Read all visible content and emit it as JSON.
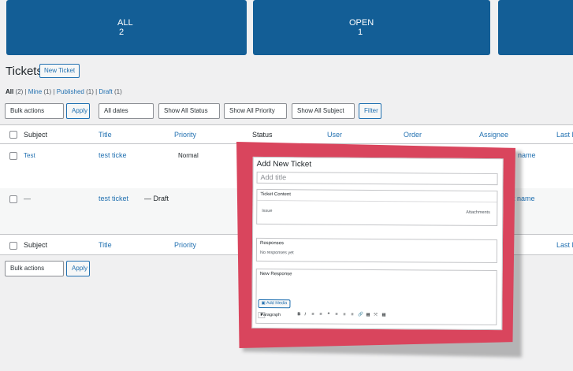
{
  "stats": {
    "all": {
      "label": "ALL",
      "value": "2"
    },
    "open": {
      "label": "OPEN",
      "value": "1"
    }
  },
  "header": {
    "title": "Tickets",
    "new_button": "New Ticket"
  },
  "filters": {
    "all": "All",
    "all_count": "(2)",
    "mine": "Mine",
    "mine_count": "(1)",
    "published": "Published",
    "published_count": "(1)",
    "draft": "Draft",
    "draft_count": "(1)",
    "separator": "|"
  },
  "toolbar": {
    "bulk_actions": "Bulk actions",
    "apply": "Apply",
    "all_dates": "All dates",
    "show_all_status": "Show All Status",
    "show_all_priority": "Show All Priority",
    "show_all_subject": "Show All Subject",
    "filter": "Filter"
  },
  "table": {
    "columns": [
      "Subject",
      "Title",
      "Priority",
      "Status",
      "User",
      "Order",
      "Assignee",
      "Last R"
    ],
    "rows": [
      {
        "subject": "Test",
        "title": "test ticke",
        "priority": "Normal",
        "assignee_partial": "name"
      },
      {
        "subject": "—",
        "title": "test ticket",
        "title_suffix": "— Draft",
        "assignee_partial": "t name"
      }
    ]
  },
  "bottom_toolbar": {
    "bulk_actions": "Bulk actions",
    "apply": "Apply"
  },
  "modal": {
    "title": "Add New Ticket",
    "title_placeholder": "Add title",
    "ticket_content": "Ticket Content",
    "issue": "Issue",
    "attachments": "Attachments",
    "responses": "Responses",
    "no_responses": "No responses yet",
    "new_response": "New Response",
    "add_media": "Add Media",
    "paragraph": "Paragraph",
    "toolbar_icons": [
      "B",
      "I",
      "≡",
      "≡",
      "❝",
      "≡",
      "≡",
      "≡",
      "🔗",
      "▦",
      "⤧",
      "▦"
    ]
  },
  "colors": {
    "primary": "#135e96",
    "link": "#2271b1",
    "overlay_frame": "#d9455d"
  }
}
